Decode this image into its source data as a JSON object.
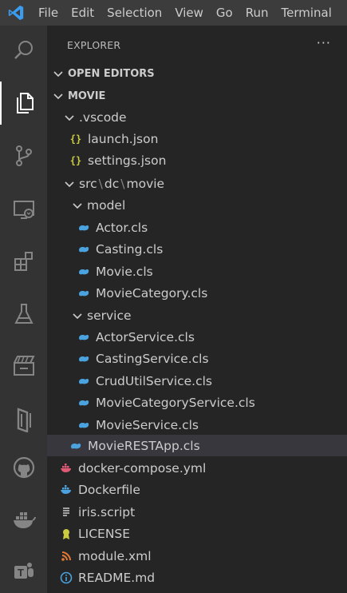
{
  "menu": [
    "File",
    "Edit",
    "Selection",
    "View",
    "Go",
    "Run",
    "Terminal"
  ],
  "activity_bar": [
    {
      "icon": "search-icon"
    },
    {
      "icon": "explorer-files-icon",
      "active": true
    },
    {
      "icon": "source-control-icon"
    },
    {
      "icon": "remote-explorer-icon"
    },
    {
      "icon": "extensions-icon"
    },
    {
      "icon": "testing-flask-icon"
    },
    {
      "icon": "intersystems-objectscript-icon"
    },
    {
      "icon": "intersystems-servers-icon"
    },
    {
      "icon": "github-icon"
    },
    {
      "icon": "docker-icon"
    },
    {
      "icon": "teams-icon"
    }
  ],
  "explorer": {
    "title": "EXPLORER",
    "more": "···",
    "open_editors": "OPEN EDITORS",
    "workspace": "MOVIE",
    "vscode_folder": ".vscode",
    "launch": "launch.json",
    "settings": "settings.json",
    "src_path": {
      "a": "src",
      "b": "dc",
      "c": "movie",
      "sep": "\\"
    },
    "model_folder": "model",
    "model_files": [
      "Actor.cls",
      "Casting.cls",
      "Movie.cls",
      "MovieCategory.cls"
    ],
    "service_folder": "service",
    "service_files": [
      "ActorService.cls",
      "CastingService.cls",
      "CrudUtilService.cls",
      "MovieCategoryService.cls",
      "MovieService.cls"
    ],
    "rest_app": "MovieRESTApp.cls",
    "root_files": {
      "compose": "docker-compose.yml",
      "dockerfile": "Dockerfile",
      "iris": "iris.script",
      "license": "LICENSE",
      "module": "module.xml",
      "readme": "README.md"
    }
  },
  "colors": {
    "accent": "#3794ff",
    "cls_icon": "#4aa3df",
    "docker": "#e05a75",
    "json": "#cbcb41",
    "xml": "#e37933"
  }
}
